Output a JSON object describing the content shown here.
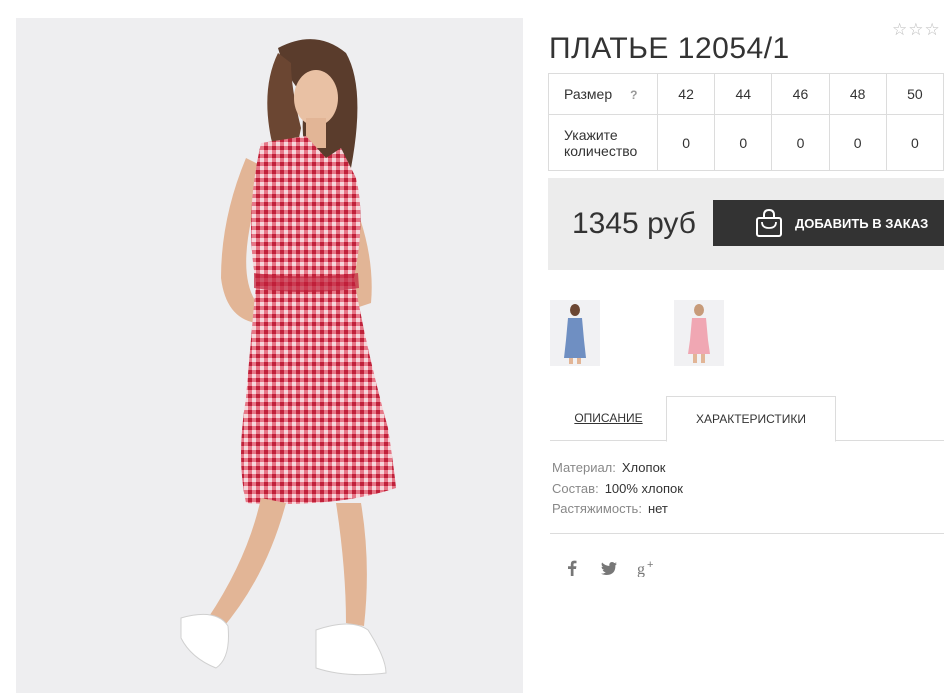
{
  "product": {
    "title": "ПЛАТЬЕ 12054/1",
    "rating_stars": "☆☆☆"
  },
  "size_table": {
    "size_label": "Размер",
    "help_icon_text": "?",
    "qty_label": "Укажите количество",
    "sizes": [
      "42",
      "44",
      "46",
      "48",
      "50"
    ],
    "quantities": [
      "0",
      "0",
      "0",
      "0",
      "0"
    ]
  },
  "order": {
    "price": "1345 руб",
    "add_button_label": "ДОБАВИТЬ В ЗАКАЗ"
  },
  "gallery": {
    "thumbnails": [
      {
        "name": "thumbnail-blue-dress",
        "color": "#6f8fc2"
      },
      {
        "name": "thumbnail-pink-dress",
        "color": "#f0a7b3"
      }
    ]
  },
  "tabs": {
    "description": "ОПИСАНИЕ",
    "characteristics": "ХАРАКТЕРИСТИКИ",
    "active": "characteristics"
  },
  "specs": [
    {
      "key": "Материал:",
      "value": "Хлопок"
    },
    {
      "key": "Состав:",
      "value": "100% хлопок"
    },
    {
      "key": "Растяжимость:",
      "value": "нет"
    }
  ],
  "social": [
    {
      "icon": "facebook-icon",
      "glyph": "f"
    },
    {
      "icon": "twitter-icon",
      "glyph": "t"
    },
    {
      "icon": "google-plus-icon",
      "glyph": "g+"
    }
  ],
  "colors": {
    "button_bg": "#333333",
    "price_box_bg": "#ececec",
    "dress_red": "#d8334a"
  }
}
